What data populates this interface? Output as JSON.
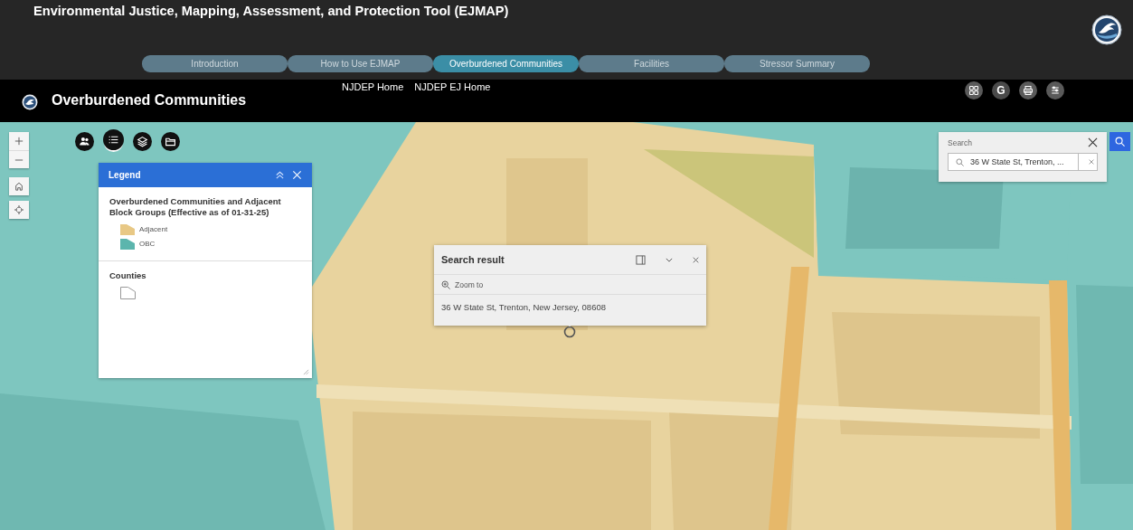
{
  "header": {
    "title": "Environmental Justice, Mapping, Assessment, and Protection Tool (EJMAP)",
    "tabs": [
      {
        "label": "Introduction",
        "selected": false
      },
      {
        "label": "How to Use EJMAP",
        "selected": false
      },
      {
        "label": "Overburdened Communities",
        "selected": true
      },
      {
        "label": "Facilities",
        "selected": false
      },
      {
        "label": "Stressor Summary",
        "selected": false
      }
    ]
  },
  "app_bar": {
    "title": "Overburdened Communities",
    "links": [
      "NJDEP Home",
      "NJDEP EJ Home"
    ],
    "buttons": [
      {
        "kind": "grid"
      },
      {
        "kind": "letter",
        "label": "G"
      },
      {
        "kind": "print"
      },
      {
        "kind": "list"
      }
    ]
  },
  "widgets": [
    {
      "kind": "people",
      "selected": false
    },
    {
      "kind": "list",
      "selected": true
    },
    {
      "kind": "layers",
      "selected": false
    },
    {
      "kind": "folder",
      "selected": false
    }
  ],
  "legend": {
    "title": "Legend",
    "layers": [
      {
        "title": "Overburdened Communities and Adjacent Block Groups (Effective as of 01-31-25)",
        "items": [
          {
            "kind": "fill",
            "label": "Adjacent",
            "color": "#e8c885"
          },
          {
            "kind": "fill",
            "label": "OBC",
            "color": "#5cb5ad"
          }
        ]
      },
      {
        "title": "Counties",
        "items": [
          {
            "kind": "outline"
          }
        ]
      }
    ]
  },
  "popup": {
    "title": "Search result",
    "action": "Zoom to",
    "content": "36 W State St, Trenton, New Jersey, 08608"
  },
  "search": {
    "label": "Search",
    "value": "36 W State St, Trenton, ..."
  }
}
